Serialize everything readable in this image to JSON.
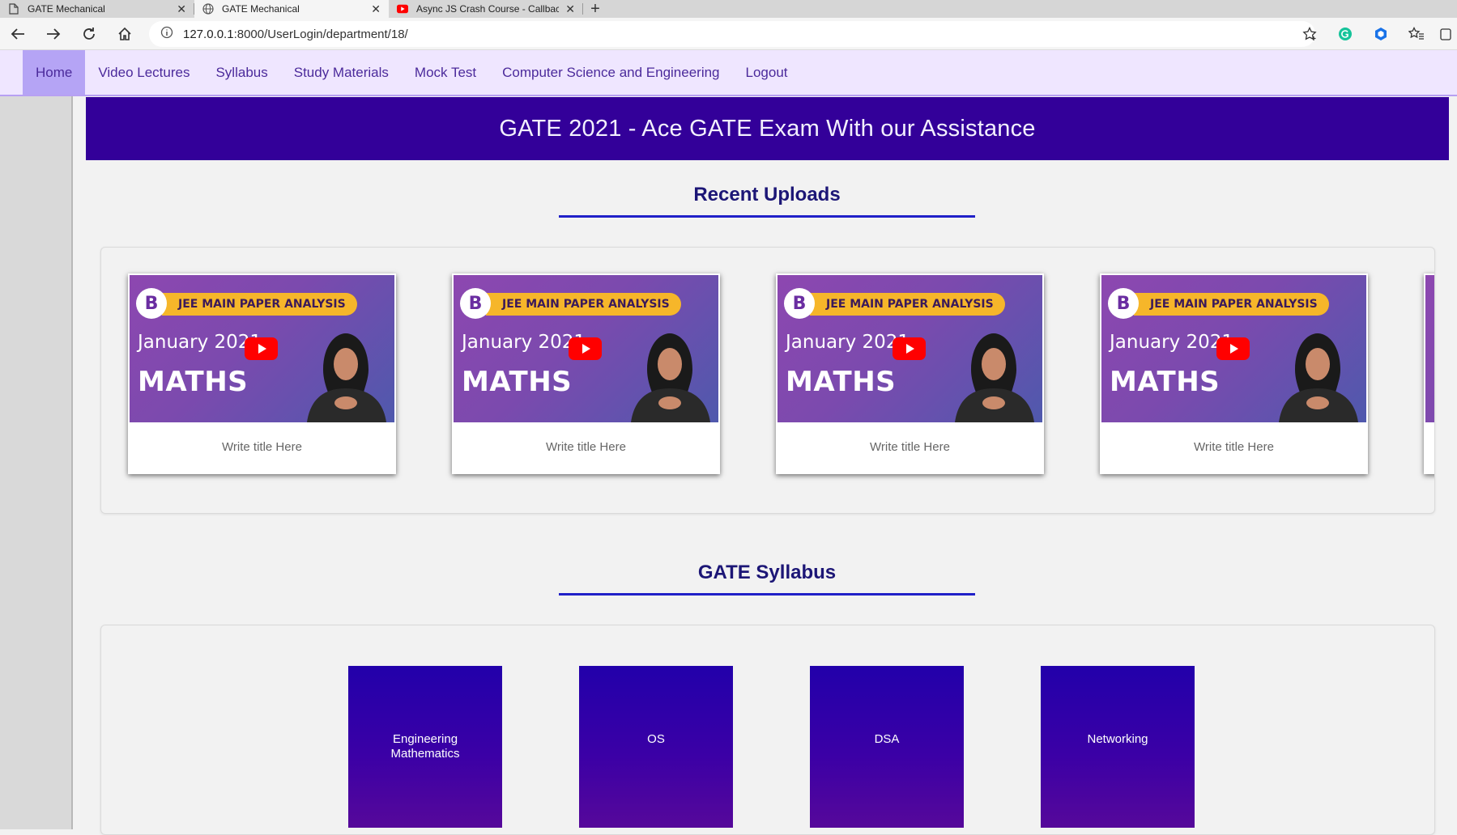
{
  "browser": {
    "tabs": [
      {
        "title": "GATE Mechanical",
        "favicon": "page-icon",
        "active": false
      },
      {
        "title": "GATE Mechanical",
        "favicon": "globe-icon",
        "active": true
      },
      {
        "title": "Async JS Crash Course - Callbacks",
        "favicon": "youtube-icon",
        "active": false
      }
    ],
    "new_tab": "+",
    "close_glyph": "✕",
    "url": "127.0.0.1:8000/UserLogin/department/18/",
    "url_host": "127.0.0.1",
    "url_rest": ":8000/UserLogin/department/18/"
  },
  "nav": {
    "items": [
      {
        "label": "Home",
        "active": true
      },
      {
        "label": "Video Lectures"
      },
      {
        "label": "Syllabus"
      },
      {
        "label": "Study Materials"
      },
      {
        "label": "Mock Test"
      },
      {
        "label": "Computer Science and Engineering"
      },
      {
        "label": "Logout"
      }
    ]
  },
  "hero": {
    "title": "GATE 2021 - Ace GATE Exam With our Assistance"
  },
  "recent_uploads": {
    "heading": "Recent Uploads",
    "cards": [
      {
        "badge": "JEE MAIN PAPER ANALYSIS",
        "month": "January 2021",
        "subject": "MATHS",
        "title": "Write title Here"
      },
      {
        "badge": "JEE MAIN PAPER ANALYSIS",
        "month": "January 2021",
        "subject": "MATHS",
        "title": "Write title Here"
      },
      {
        "badge": "JEE MAIN PAPER ANALYSIS",
        "month": "January 2021",
        "subject": "MATHS",
        "title": "Write title Here"
      },
      {
        "badge": "JEE MAIN PAPER ANALYSIS",
        "month": "January 2021",
        "subject": "MATHS",
        "title": "Write title Here"
      }
    ]
  },
  "syllabus": {
    "heading": "GATE Syllabus",
    "items": [
      "Engineering Mathematics",
      "OS",
      "DSA",
      "Networking"
    ]
  },
  "colors": {
    "hero_bg": "#330099",
    "nav_bg": "#efe6ff",
    "nav_active": "#b5a4f5",
    "heading": "#1c1676",
    "underline": "#2020c8"
  }
}
